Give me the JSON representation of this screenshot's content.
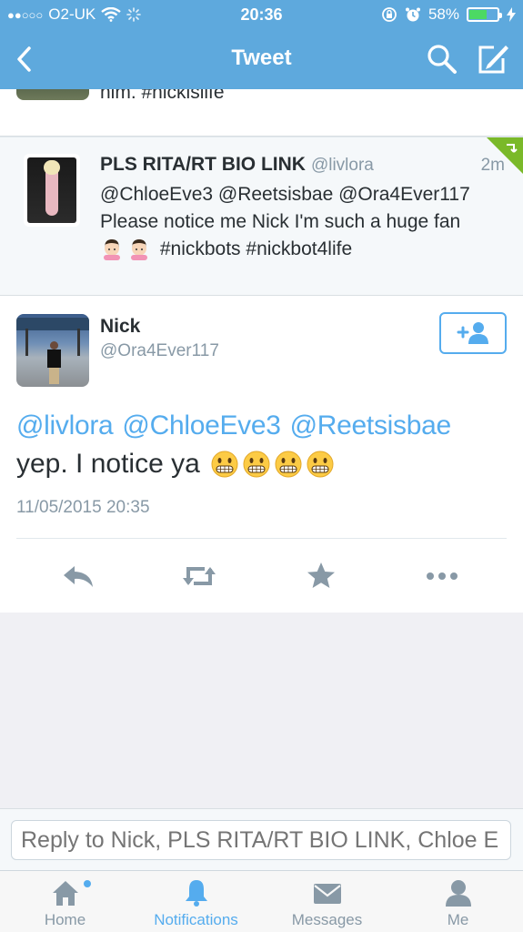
{
  "status_bar": {
    "signal": "●●○○○",
    "carrier": "O2-UK",
    "time": "20:36",
    "battery_percent": "58%",
    "battery_level": 0.58
  },
  "nav": {
    "title": "Tweet",
    "back_icon": "chevron-left-icon",
    "search_icon": "search-icon",
    "compose_icon": "compose-icon"
  },
  "previous_tweet": {
    "partial_text": "him. #nickislife"
  },
  "reply_tweet": {
    "name": "PLS RITA/RT BIO LINK",
    "handle": "@livlora",
    "time": "2m",
    "mentions": "@ChloeEve3 @Reetsisbae @Ora4Ever117",
    "text": "Please notice me Nick I'm such a huge fan",
    "hashtags": "#nickbots #nickbot4life"
  },
  "main_tweet": {
    "name": "Nick",
    "handle": "@Ora4Ever117",
    "mentions": [
      "@livlora",
      "@ChloeEve3",
      "@Reetsisbae"
    ],
    "text": "yep. I notice ya",
    "date": "11/05/2015 20:35",
    "actions": [
      "reply-icon",
      "retweet-icon",
      "favorite-icon",
      "more-icon"
    ]
  },
  "reply_bar": {
    "placeholder": "Reply to Nick, PLS RITA/RT BIO LINK, Chloe E"
  },
  "tabs": [
    {
      "label": "Home",
      "icon": "home-icon"
    },
    {
      "label": "Notifications",
      "icon": "bell-icon"
    },
    {
      "label": "Messages",
      "icon": "envelope-icon"
    },
    {
      "label": "Me",
      "icon": "person-icon"
    }
  ],
  "colors": {
    "header": "#5ea9dd",
    "accent": "#55acee",
    "muted": "#8899a6",
    "retweet_flag": "#7ab929"
  }
}
